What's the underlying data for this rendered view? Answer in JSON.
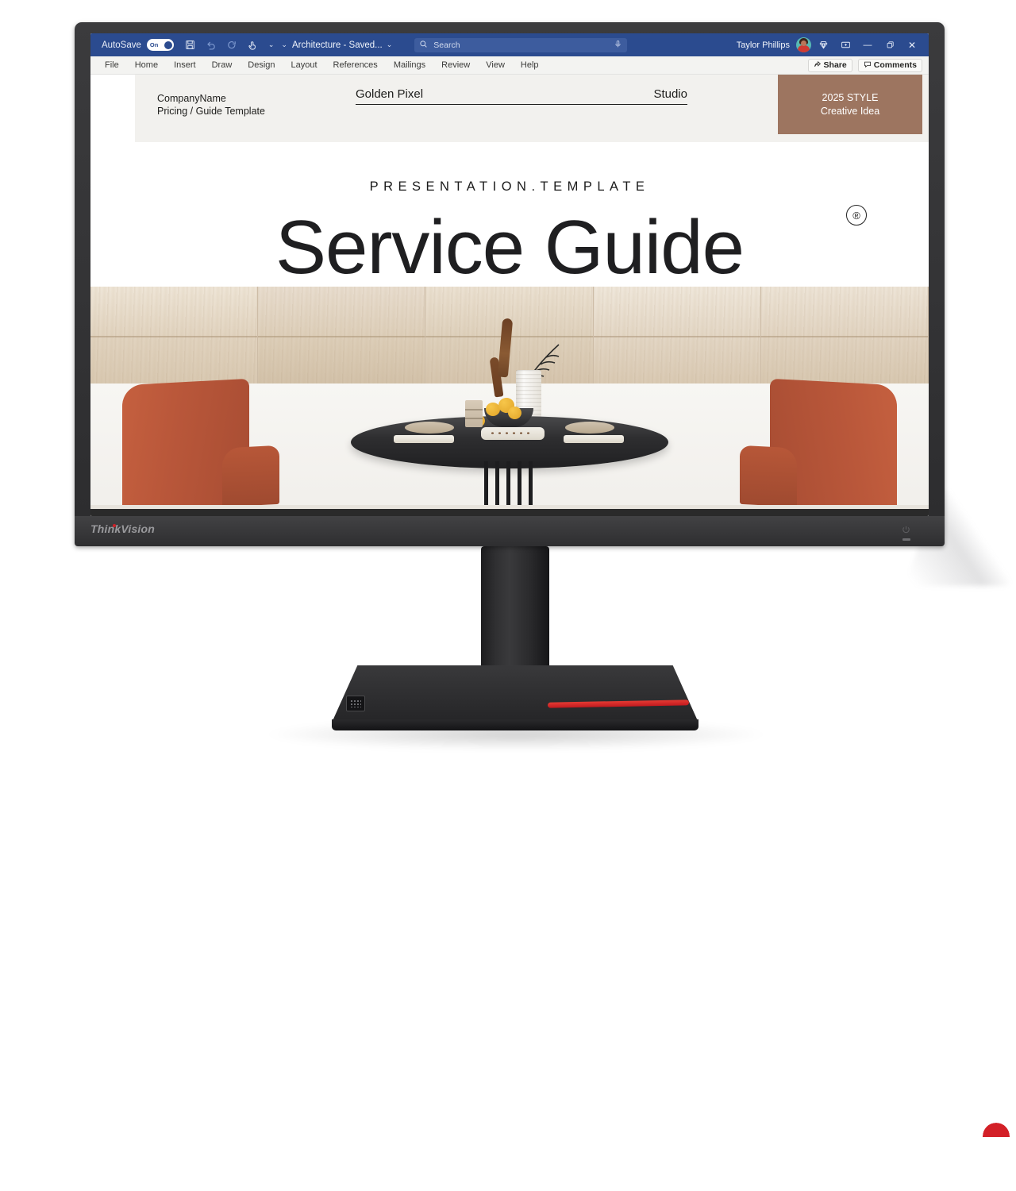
{
  "app": {
    "titlebar": {
      "autosave_label": "AutoSave",
      "autosave_state": "On",
      "document_title": "Architecture - Saved...",
      "save_icon": "save-icon",
      "undo_icon": "undo-icon",
      "redo_icon": "redo-icon",
      "touch_icon": "touch-mode-icon",
      "customize_caret": "⌄",
      "ribbon_caret": "⌄",
      "title_caret": "⌄",
      "search_placeholder": "Search",
      "search_icon": "search-icon",
      "mic_icon": "microphone-icon",
      "user_name": "Taylor Phillips",
      "avatar": "user-avatar",
      "diamond_icon": "diamond-icon",
      "display_options_icon": "display-options-icon",
      "minimize_label": "—",
      "restore_label": "❐",
      "close_label": "✕"
    },
    "ribbon": {
      "tabs": [
        {
          "label": "File"
        },
        {
          "label": "Home"
        },
        {
          "label": "Insert"
        },
        {
          "label": "Draw"
        },
        {
          "label": "Design"
        },
        {
          "label": "Layout"
        },
        {
          "label": "References"
        },
        {
          "label": "Mailings"
        },
        {
          "label": "Review"
        },
        {
          "label": "View"
        },
        {
          "label": "Help"
        }
      ],
      "share_label": "Share",
      "share_icon": "share-icon",
      "comments_label": "Comments",
      "comments_icon": "comment-icon"
    }
  },
  "document": {
    "header": {
      "company_line1": "CompanyName",
      "company_line2": "Pricing / Guide Template",
      "brand_left": "Golden Pixel",
      "brand_right": "Studio",
      "badge_line1": "2025 STYLE",
      "badge_line2": "Creative Idea",
      "badge_color": "#9d7560"
    },
    "kicker": "PRESENTATION.TEMPLATE",
    "headline": "Service Guide",
    "trademark": "®",
    "photo": {
      "alt": "Dining room with round black table, two terracotta chairs, vase with dried pampas grass, bowl of lemons and set plates against a wood-panel and white wall",
      "chair_color": "#b9573a",
      "table_color": "#2e2e30",
      "wood_color": "#e1d3bf"
    }
  },
  "hardware": {
    "brand_logo": "ThinkVision",
    "power_icon": "power-icon",
    "led_indicator": "status-led",
    "accent_color": "#cf2028",
    "bezel_color": "#343436"
  }
}
